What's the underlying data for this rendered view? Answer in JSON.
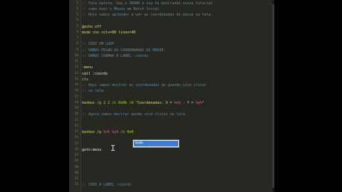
{
  "editor": {
    "lines": [
      {
        "n": "1",
        "segs": [
          {
            "t": ":: Fala Galera. Sou o ZHARD e vou te mostrando nesse tutorial",
            "c": "t-comment"
          }
        ]
      },
      {
        "n": "2",
        "segs": [
          {
            "t": ":: como usar o Mouse em Batch Script",
            "c": "t-comment"
          }
        ]
      },
      {
        "n": "3",
        "segs": [
          {
            "t": ":: Hoje vamos aprender a ver as coordenadas do mouse na tela.",
            "c": "t-comment"
          }
        ]
      },
      {
        "n": "4",
        "segs": []
      },
      {
        "n": "5",
        "segs": [
          {
            "t": "@echo off",
            "c": "t-kw"
          }
        ]
      },
      {
        "n": "6",
        "segs": [
          {
            "t": "mode con cols=80 lines=40",
            "c": "t-kw"
          }
        ]
      },
      {
        "n": "7",
        "segs": []
      },
      {
        "n": "8",
        "segs": [
          {
            "t": ":: CRIE UM LOOP",
            "c": "t-comment"
          }
        ]
      },
      {
        "n": "9",
        "segs": [
          {
            "t": ":: VAMOS PEGAR AS COORDENADAS DO MOUSE.",
            "c": "t-comment"
          }
        ]
      },
      {
        "n": "10",
        "segs": [
          {
            "t": ":: VAMOS CHAMAR A LABEL :coords",
            "c": "t-comment"
          }
        ]
      },
      {
        "n": "11",
        "segs": []
      },
      {
        "n": "12",
        "segs": [
          {
            "t": ":menu",
            "c": "t-kw"
          }
        ]
      },
      {
        "n": "13",
        "segs": [
          {
            "t": "call :coords",
            "c": "t-normal"
          }
        ]
      },
      {
        "n": "14",
        "segs": [
          {
            "t": "cls",
            "c": "t-kw"
          }
        ]
      },
      {
        "n": "15",
        "segs": [
          {
            "t": ":: Aqui vamos mostrar as coordenadas de quando você clicar",
            "c": "t-comment"
          }
        ]
      },
      {
        "n": "16",
        "segs": [
          {
            "t": ":: na tela",
            "c": "t-comment"
          }
        ]
      },
      {
        "n": "17",
        "segs": []
      },
      {
        "n": "18",
        "segs": [
          {
            "t": "batbox ",
            "c": "t-kw"
          },
          {
            "t": "/g 2 2 /c 0x0b /d ",
            "c": "t-grn"
          },
          {
            "t": "\"Coordenadas: X = ",
            "c": "t-str"
          },
          {
            "t": "%x%",
            "c": "t-var"
          },
          {
            "t": " - Y = ",
            "c": "t-str"
          },
          {
            "t": "%y%",
            "c": "t-var"
          },
          {
            "t": "\"",
            "c": "t-str"
          }
        ]
      },
      {
        "n": "19",
        "segs": []
      },
      {
        "n": "20",
        "segs": [
          {
            "t": ":: Agora vamos mostrar aonde você clicou na tela.",
            "c": "t-comment"
          }
        ]
      },
      {
        "n": "21",
        "segs": []
      },
      {
        "n": "22",
        "segs": []
      },
      {
        "n": "23",
        "segs": [
          {
            "t": "batbox ",
            "c": "t-kw"
          },
          {
            "t": "/g ",
            "c": "t-grn"
          },
          {
            "t": "%x%",
            "c": "t-var"
          },
          {
            "t": " ",
            "c": "t-normal"
          },
          {
            "t": "%y%",
            "c": "t-var"
          },
          {
            "t": " /c 0x0",
            "c": "t-grn"
          }
        ]
      },
      {
        "n": "24",
        "segs": []
      },
      {
        "n": "25",
        "segs": []
      },
      {
        "n": "26",
        "segs": [
          {
            "t": "goto:menu",
            "c": "t-normal"
          }
        ]
      },
      {
        "n": "27",
        "segs": []
      },
      {
        "n": "28",
        "segs": []
      },
      {
        "n": "29",
        "segs": []
      },
      {
        "n": "30",
        "segs": []
      },
      {
        "n": "31",
        "segs": []
      },
      {
        "n": "32",
        "segs": [
          {
            "t": ":: CRIE A LABEL :coords",
            "c": "t-comment"
          }
        ]
      }
    ],
    "autocomplete": {
      "item": "0x0b"
    }
  }
}
